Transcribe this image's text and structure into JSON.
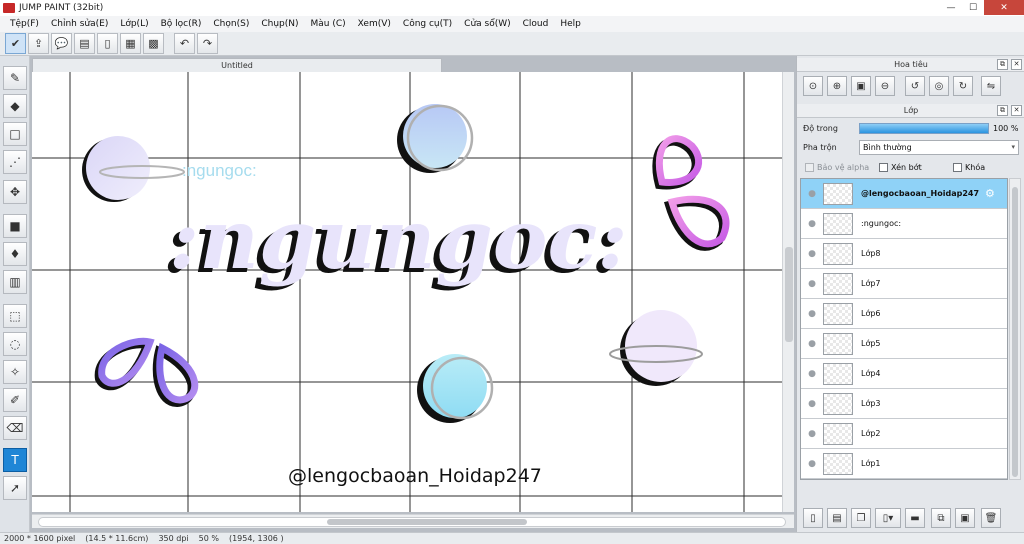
{
  "window": {
    "title": "JUMP PAINT (32bit)",
    "controls": {
      "minimize": "—",
      "maximize": "☐",
      "close": "✕"
    }
  },
  "menu": [
    "Tệp(F)",
    "Chỉnh sửa(E)",
    "Lớp(L)",
    "Bộ lọc(R)",
    "Chọn(S)",
    "Chụp(N)",
    "Màu (C)",
    "Xem(V)",
    "Công cụ(T)",
    "Cửa sổ(W)",
    "Cloud",
    "Help"
  ],
  "toolbar": {
    "icons": [
      "check-badge-icon",
      "export-icon",
      "speech-bubble-icon",
      "comment-icon",
      "page-icon",
      "grid-icon",
      "layout-icon"
    ],
    "undo": "↶",
    "redo": "↷"
  },
  "left_tools": [
    "brush-icon",
    "eraser-icon",
    "rectangle-icon",
    "dot-pen-icon",
    "move-icon",
    "fill-square-icon",
    "bucket-icon",
    "gradient-icon",
    "rect-select-icon",
    "lasso-icon",
    "magic-wand-icon",
    "select-pen-icon",
    "select-eraser-icon",
    "text-icon",
    "pointer-icon"
  ],
  "document": {
    "tab": "Untitled",
    "art_small_text": ":ngungoc:",
    "art_big_text": ":ngungoc:",
    "art_signature": "@lengocbaoan_Hoidap247",
    "colors": {
      "big_text_fill": "#e8e4fb",
      "small_text": "#a6dcee",
      "grid": "#2c2c2c"
    }
  },
  "status": {
    "size": "2000 * 1600 pixel",
    "physical": "(14.5 * 11.6cm)",
    "dpi": "350 dpi",
    "zoom": "50 %",
    "coords": "(1954, 1306 )"
  },
  "navigator": {
    "title": "Hoa tiêu",
    "buttons": [
      "zoom-fit-icon",
      "zoom-in-icon",
      "zoom-actual-icon",
      "zoom-out-icon",
      "rotate-left-icon",
      "rotate-reset-icon",
      "rotate-right-icon",
      "flip-icon"
    ]
  },
  "layers_panel": {
    "title": "Lớp",
    "opacity_label": "Độ trong",
    "opacity_value": "100 %",
    "opacity_fraction": 1.0,
    "blend_label": "Pha trộn",
    "blend_value": "Bình thường",
    "protect_alpha": "Bảo vệ alpha",
    "clip": "Xén bớt",
    "lock": "Khóa",
    "layers": [
      {
        "name": "@lengocbaoan_Hoidap247",
        "selected": true
      },
      {
        "name": ":ngungoc:",
        "selected": false
      },
      {
        "name": "Lớp8",
        "selected": false
      },
      {
        "name": "Lớp7",
        "selected": false
      },
      {
        "name": "Lớp6",
        "selected": false
      },
      {
        "name": "Lớp5",
        "selected": false
      },
      {
        "name": "Lớp4",
        "selected": false
      },
      {
        "name": "Lớp3",
        "selected": false
      },
      {
        "name": "Lớp2",
        "selected": false
      },
      {
        "name": "Lớp1",
        "selected": false
      }
    ],
    "buttons": [
      "new-layer-icon",
      "new-raster-icon",
      "copy-layer-icon",
      "new-folder-menu-icon",
      "folder-icon",
      "merge-icon",
      "combine-icon",
      "delete-layer-icon"
    ]
  }
}
